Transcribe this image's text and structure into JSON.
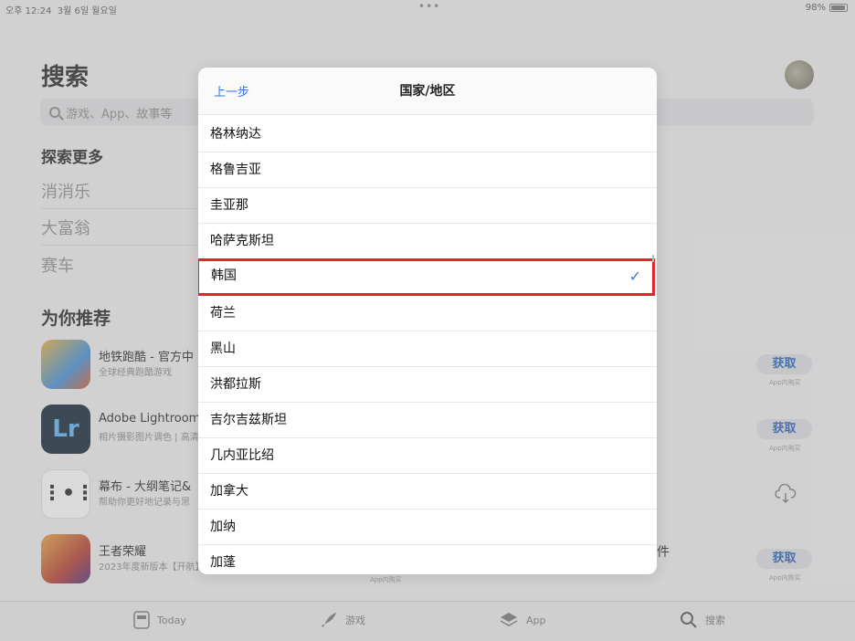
{
  "status": {
    "time": "오후 12:24",
    "date": "3월 6일 월요일",
    "battery": "98%",
    "dots": "•••"
  },
  "page": {
    "title": "搜索",
    "search_placeholder": "游戏、App、故事等"
  },
  "explore": {
    "title": "探索更多",
    "items": [
      "消消乐",
      "大富翁",
      "赛车"
    ]
  },
  "recommend": {
    "title": "为你推荐",
    "apps": [
      {
        "name": "地铁跑酷 - 官方中",
        "sub": "全球经典跑酷游戏",
        "action": "获取",
        "inapp": "App内购买"
      },
      {
        "name": "Adobe Lightroom",
        "sub": "相片摄影图片调色 | 高清",
        "action": "获取",
        "inapp": "App内购买"
      },
      {
        "name": "幕布 - 大纲笔记&",
        "sub": "帮助你更好地记录与思",
        "action": "",
        "inapp": ""
      },
      {
        "name": "王者荣耀",
        "sub": "2023年度新版本【开航】",
        "action": "获取",
        "inapp": "App内购买"
      }
    ],
    "partial_right_text": "件"
  },
  "tabs": [
    {
      "label": "Today",
      "icon": "today-icon"
    },
    {
      "label": "游戏",
      "icon": "rocket-icon"
    },
    {
      "label": "App",
      "icon": "layers-icon"
    },
    {
      "label": "搜索",
      "icon": "search-icon"
    }
  ],
  "sheet": {
    "back_label": "上一步",
    "title": "国家/地区",
    "countries": [
      "格林纳达",
      "格鲁吉亚",
      "圭亚那",
      "哈萨克斯坦",
      "韩国",
      "荷兰",
      "黑山",
      "洪都拉斯",
      "吉尔吉兹斯坦",
      "几内亚比绍",
      "加拿大",
      "加纳",
      "加蓬"
    ],
    "selected": "韩国",
    "check": "✓"
  },
  "colors": {
    "accent": "#2f7ae5",
    "highlight": "#e5232b"
  }
}
